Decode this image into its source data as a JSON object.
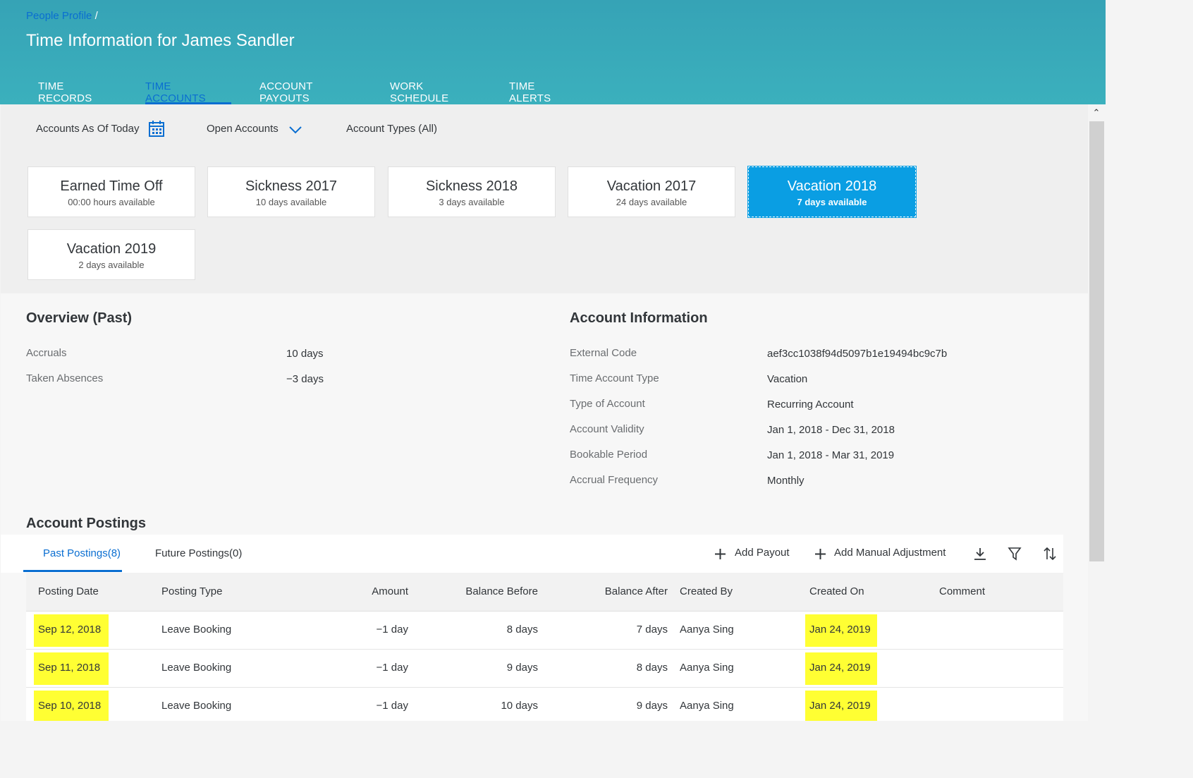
{
  "header": {
    "breadcrumb": "People Profile",
    "breadcrumb_sep": "/",
    "title": "Time Information for James Sandler",
    "tabs": [
      {
        "label": "TIME RECORDS"
      },
      {
        "label": "TIME ACCOUNTS"
      },
      {
        "label": "ACCOUNT PAYOUTS"
      },
      {
        "label": "WORK SCHEDULE"
      },
      {
        "label": "TIME ALERTS"
      }
    ],
    "active_tab": "TIME ACCOUNTS"
  },
  "filters": {
    "as_of": "Accounts As Of Today",
    "status": "Open Accounts",
    "types": "Account Types (All)"
  },
  "tiles": [
    {
      "name": "Earned Time Off",
      "sub": "00:00 hours available"
    },
    {
      "name": "Sickness 2017",
      "sub": "10 days available"
    },
    {
      "name": "Sickness 2018",
      "sub": "3 days available"
    },
    {
      "name": "Vacation 2017",
      "sub": "24 days available"
    },
    {
      "name": "Vacation 2018",
      "sub": "7 days available",
      "selected": true
    },
    {
      "name": "Vacation 2019",
      "sub": "2 days available"
    }
  ],
  "overview": {
    "title": "Overview (Past)",
    "items": [
      {
        "label": "Accruals",
        "value": "10 days"
      },
      {
        "label": "Taken Absences",
        "value": "−3 days"
      }
    ]
  },
  "account_info": {
    "title": "Account Information",
    "items": [
      {
        "label": "External Code",
        "value": "aef3cc1038f94d5097b1e19494bc9c7b"
      },
      {
        "label": "Time Account Type",
        "value": "Vacation"
      },
      {
        "label": "Type of Account",
        "value": "Recurring Account"
      },
      {
        "label": "Account Validity",
        "value": "Jan 1, 2018 - Dec 31, 2018"
      },
      {
        "label": "Bookable Period",
        "value": "Jan 1, 2018 - Mar 31, 2019"
      },
      {
        "label": "Accrual Frequency",
        "value": "Monthly"
      }
    ]
  },
  "postings": {
    "title": "Account Postings",
    "tabs": [
      "Past Postings(8)",
      "Future Postings(0)"
    ],
    "add_payout": "Add Payout",
    "add_adjustment": "Add Manual Adjustment",
    "columns": [
      "Posting Date",
      "Posting Type",
      "Amount",
      "Balance Before",
      "Balance After",
      "Created By",
      "Created On",
      "Comment"
    ],
    "rows": [
      {
        "date": "Sep 12, 2018",
        "type": "Leave Booking",
        "amount": "−1 day",
        "before": "8 days",
        "after": "7 days",
        "by": "Aanya Sing",
        "on": "Jan 24, 2019",
        "comment": ""
      },
      {
        "date": "Sep 11, 2018",
        "type": "Leave Booking",
        "amount": "−1 day",
        "before": "9 days",
        "after": "8 days",
        "by": "Aanya Sing",
        "on": "Jan 24, 2019",
        "comment": ""
      },
      {
        "date": "Sep 10, 2018",
        "type": "Leave Booking",
        "amount": "−1 day",
        "before": "10 days",
        "after": "9 days",
        "by": "Aanya Sing",
        "on": "Jan 24, 2019",
        "comment": ""
      }
    ]
  },
  "colors": {
    "header": "#3bb0bd",
    "accent": "#0a6ed1",
    "tile_selected": "#0a9ee3",
    "highlight": "#ffff33"
  }
}
